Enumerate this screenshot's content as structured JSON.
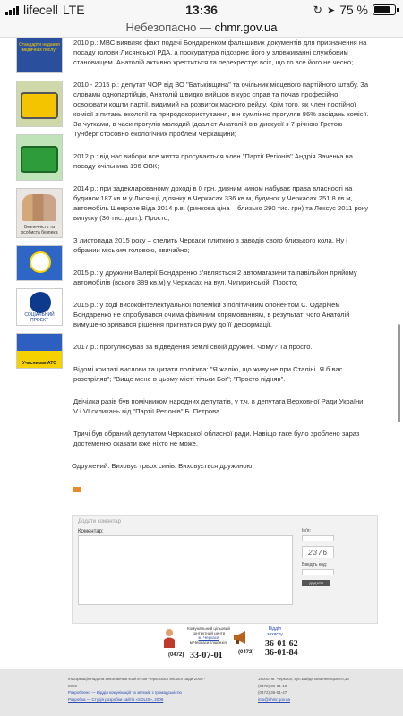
{
  "status_bar": {
    "carrier": "lifecell",
    "network": "LTE",
    "time": "13:36",
    "battery_percent": "75 %",
    "battery_level": 0.75
  },
  "browser": {
    "security_label": "Небезопасно —",
    "host": "chmr.gov.ua"
  },
  "article": {
    "paragraphs": [
      "2010 р.: МВС виявляє факт подачі Бондаренком фальшивих документів для призначення на посаду голови Лисянської РДА, а прокуратура підозрює його у зловживанні службовим становищем. Анатолій активно хреститься та перехрестує всіх, що то все його не чесно;",
      "2010 - 2015 р.: депутат ЧОР від ВО \"Батьківщина\" та очільник місцевого партійного штабу. За словами однопартійців, Анатолій швидко вийшов в курс справ та почав професійно освоювати кошти партії, видимий на розвиток масного рейду. Крім того, як член постійної комісії з питань екології та природокористування, він сумлінно прогуляв 86% засідань комісії. За чутками, в часи прогулів молодий Ідеаліст Анатолій вів дискусії з 7-річною Гретою Тунберг стосовно екологічних проблем Черкащини;",
      "2012 р.: від нас вибори все життя просувається член \"Партії Регіонів\" Андрія Заченка на посаду очільника 196 ОВК;",
      "2014 р.: при задекларованому доході в 0 грн. дивним чином набуває права власності на будинок 187 кв.м у Лисянці, ділянку в Черкасах 336 кв.м, будинок у Черкасах 251.8 кв.м, автомобіль Шевроле Віда 2014 р.в. (ринкова ціна – близько 290 тис. грн) та Лексус 2011 року випуску (36 тис. дол.). Просто;",
      "З листопада 2015 року – стелить Черкаси плиткою з заводів свого близького кола. Ну і обрании міським головою, звичайно;",
      "2015 р.: у дружини Валерії Бондаренко з'являється 2 автомагазини та павільйон прийому автомобілів (всього 389 кв.м) у Черкасах на вул. Чигиринській. Просто;",
      "2015 р.: у ході високоінтелектуальної полеміки з політичним опонентом С. Одарічем Бондаренко не спробувався очима фізичним спрямованням, в результаті чого Анатолій вимушено зривався рішення пригнатися руку до її деформації.",
      "2017 р.: прогулюсував за відведення землі своїй дружині. Чому? Та просто.",
      "Відомі крилаті вислови та цитати політика: \"Я жалію, що живу не при Сталіні. Я б вас розстріляв\"; \"Вище мене в цьому місті тільки Бог\"; \"Просто підняв\".",
      "Двічілка разів був помічником народних депутатів, у т.ч. в депутата Верховної Ради України V і VI скликань від \"Партії Регіонів\" Б. Петрова.",
      "Тричі був обраний депутатом Черкаської обласної ради. Навіщо таке було зроблено зараз достеменно сказати вже ніхто не може."
    ],
    "signature": "Одружений. Виховує трьох синів. Виховується дружиною."
  },
  "comment_form": {
    "title": "Додати коментар",
    "comment_label": "Коментар:",
    "name_label": "Ім'я:",
    "captcha_label": "Введіть код:",
    "captcha_value": "2376",
    "submit_label": "ДОДАТИ"
  },
  "contacts": {
    "contact_center": {
      "label": "Комунальний цільовий контактний центр",
      "label_link": "м. Черкаси",
      "label_suffix": "м.Черкаси (ліцензія)",
      "code": "(0472)",
      "number": "33-07-01"
    },
    "duty_office": {
      "label": "Відділ",
      "label2": "захисту",
      "code": "(0472)",
      "number1": "36-01-62",
      "number2": "36-01-84"
    }
  },
  "footer": {
    "left_lines": [
      "Інформація надана виконавчим комітетом Черкаської міської ради 2008 - 2020",
      "Розроблено — Відділ комунікацій та зв'язків з громадськістю",
      "Розробка — Студія розробки сайтів «SOLIS», 2008"
    ],
    "right_lines": [
      "18000, м. Черкаси, вул.Байди Вишневецького,36",
      "(0472) 36-01-10",
      "(0472) 36-01-47",
      "info@chmr.gov.ua"
    ]
  },
  "sidebar_banners": [
    {
      "icon": "document-banner-icon",
      "text": "Стандарти надання медичних послуг"
    },
    {
      "icon": "bus-icon",
      "text": ""
    },
    {
      "icon": "green-bus-icon",
      "text": ""
    },
    {
      "icon": "people-icon",
      "text": "Безпечність та особиста безпека"
    },
    {
      "icon": "emblem-icon",
      "text": ""
    },
    {
      "icon": "social-emblem-icon",
      "text": "СОЦІАЛЬНИЙ ПРОЕКТ"
    },
    {
      "icon": "flag-icon",
      "text": "Учасникам АТО"
    }
  ]
}
